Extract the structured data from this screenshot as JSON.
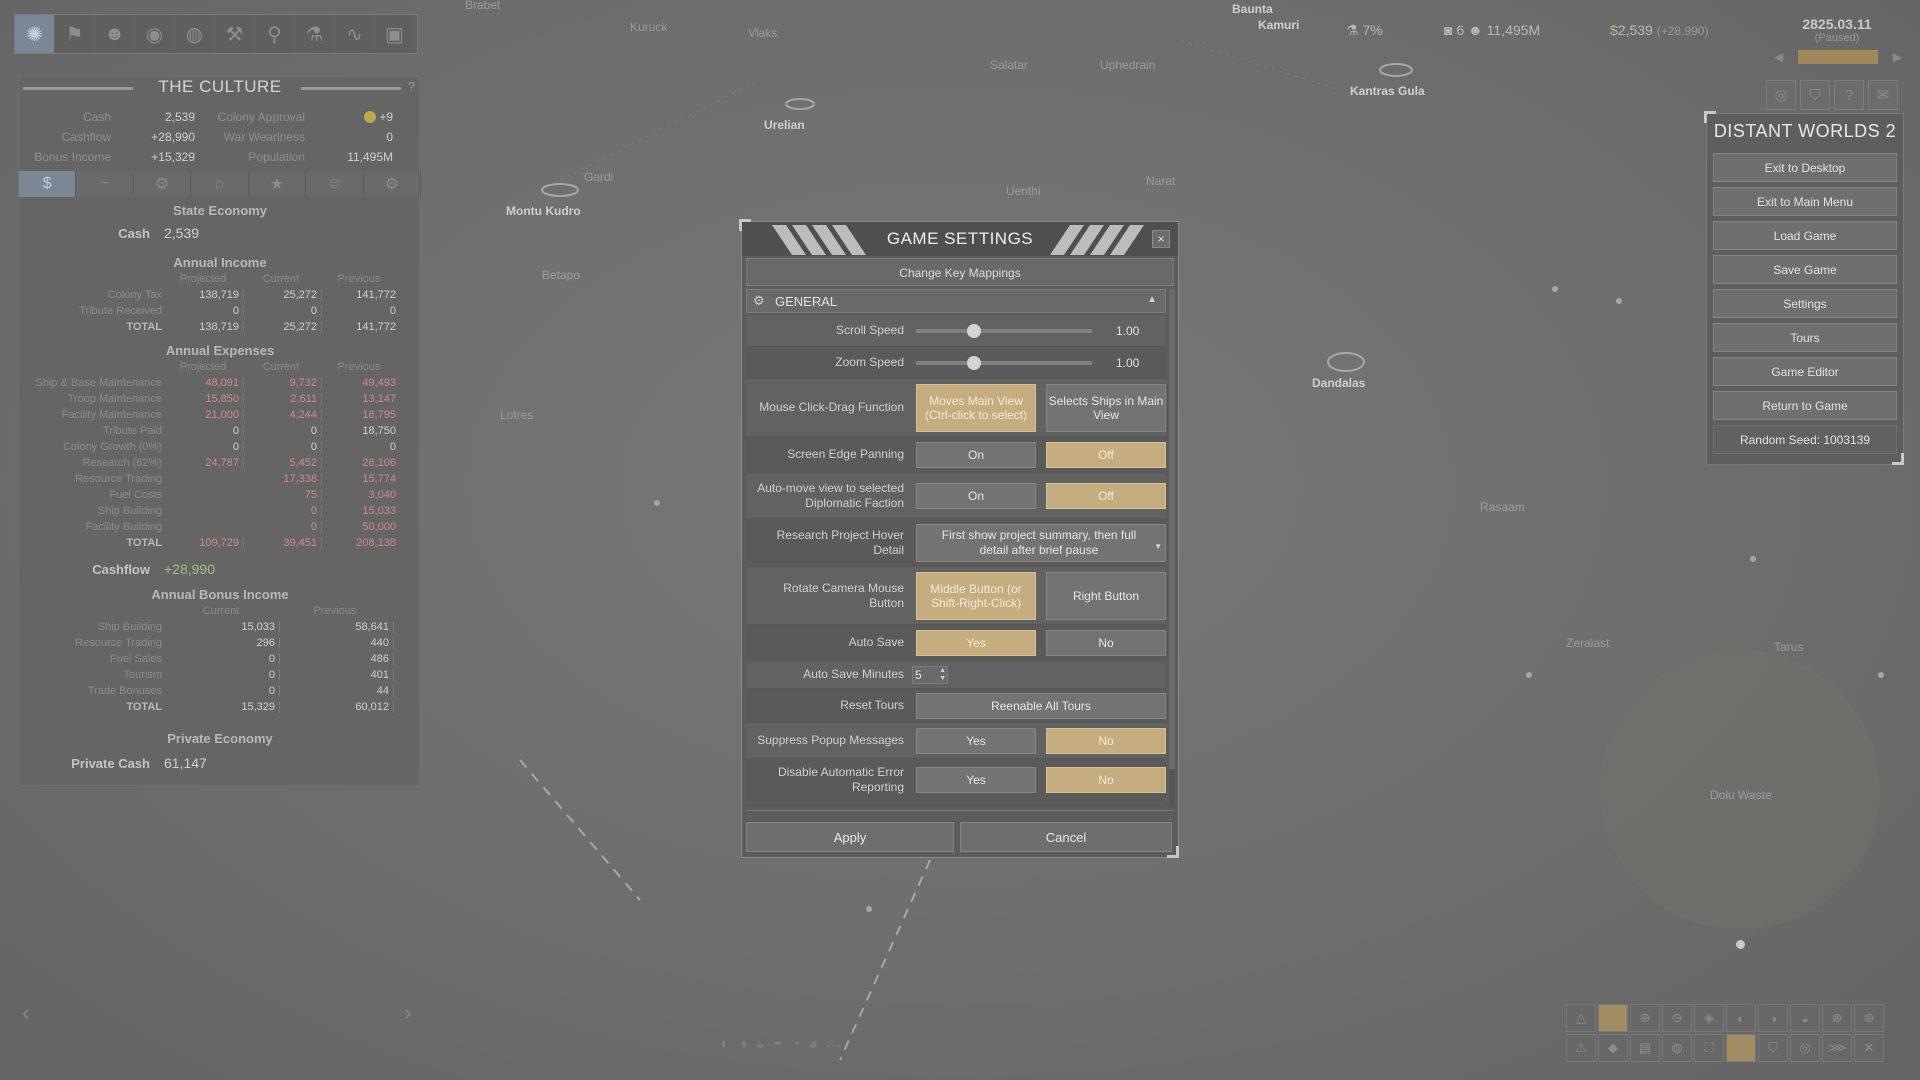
{
  "map": {
    "labels": [
      "Brabet",
      "Kuruck",
      "Vlaks",
      "Salatar",
      "Uphedrain",
      "Kamuri",
      "Baunta",
      "Kantras Gula",
      "Urelian",
      "Montu Kudro",
      "Gardi",
      "Narat",
      "Uenthi",
      "Betapo",
      "Lotres",
      "Dandalas",
      "Zeralast",
      "Dolu Waste",
      "Tarus",
      "Rasaam"
    ]
  },
  "toolbar": {
    "icons": [
      "empire-icon",
      "flag-icon",
      "person-icon",
      "camera-icon",
      "globe-icon",
      "tools-icon",
      "pin-icon",
      "flask-icon",
      "graph-icon",
      "factory-icon"
    ]
  },
  "empire": {
    "title": "THE CULTURE",
    "help": "?",
    "stats": [
      {
        "l1": "Cash",
        "v1": "2,539",
        "l2": "Colony Approval",
        "v2": "+9"
      },
      {
        "l1": "Cashflow",
        "v1": "+28,990",
        "l2": "War Weariness",
        "v2": "0"
      },
      {
        "l1": "Bonus Income",
        "v1": "+15,329",
        "l2": "Population",
        "v2": "11,495M"
      }
    ],
    "tabs": [
      "$",
      "~",
      "⚙",
      "⌂",
      "★",
      "☺",
      "⚙"
    ],
    "state_economy": "State Economy",
    "cash_label": "Cash",
    "cash_value": "2,539",
    "annual_income": "Annual Income",
    "col_projected": "Projected",
    "col_current": "Current",
    "col_previous": "Previous",
    "income_rows": [
      {
        "name": "Colony Tax",
        "p": "138,719",
        "c": "25,272",
        "v": "141,772"
      },
      {
        "name": "Tribute Received",
        "p": "0",
        "c": "0",
        "v": "0"
      },
      {
        "name": "TOTAL",
        "p": "138,719",
        "c": "25,272",
        "v": "141,772"
      }
    ],
    "annual_expenses": "Annual Expenses",
    "expense_rows": [
      {
        "name": "Ship & Base Maintenance",
        "p": "48,091",
        "c": "9,732",
        "v": "49,493",
        "red": true
      },
      {
        "name": "Troop Maintenance",
        "p": "15,850",
        "c": "2,611",
        "v": "13,147",
        "red": true
      },
      {
        "name": "Facility Maintenance",
        "p": "21,000",
        "c": "4,244",
        "v": "16,795",
        "red": true
      },
      {
        "name": "Tribute Paid",
        "p": "0",
        "c": "0",
        "v": "18,750",
        "red": false
      },
      {
        "name": "Colony Growth (0%)",
        "p": "0",
        "c": "0",
        "v": "0",
        "red": false
      },
      {
        "name": "Research (62%)",
        "p": "24,787",
        "c": "5,452",
        "v": "26,106",
        "red": true
      },
      {
        "name": "Resource Trading",
        "p": "",
        "c": "17,338",
        "v": "15,774",
        "red": true
      },
      {
        "name": "Fuel Costs",
        "p": "",
        "c": "75",
        "v": "3,040",
        "red": true
      },
      {
        "name": "Ship Building",
        "p": "",
        "c": "0",
        "v": "15,033",
        "red": true
      },
      {
        "name": "Facility Building",
        "p": "",
        "c": "0",
        "v": "50,000",
        "red": true
      },
      {
        "name": "TOTAL",
        "p": "109,729",
        "c": "39,451",
        "v": "208,138",
        "red": true
      }
    ],
    "cashflow_label": "Cashflow",
    "cashflow_value": "+28,990",
    "annual_bonus": "Annual Bonus Income",
    "bonus_rows": [
      {
        "name": "Ship Building",
        "c": "15,033",
        "v": "58,641"
      },
      {
        "name": "Resource Trading",
        "c": "296",
        "v": "440"
      },
      {
        "name": "Fuel Sales",
        "c": "0",
        "v": "486"
      },
      {
        "name": "Tourism",
        "c": "0",
        "v": "401"
      },
      {
        "name": "Trade Bonuses",
        "c": "0",
        "v": "44"
      },
      {
        "name": "TOTAL",
        "c": "15,329",
        "v": "60,012"
      }
    ],
    "private_economy": "Private Economy",
    "private_cash_label": "Private Cash",
    "private_cash_value": "61,147"
  },
  "hud": {
    "research": "7%",
    "colonies": "6",
    "population": "11,495M",
    "cash": "2,539",
    "cashflow": "(+28,990)",
    "date": "2825.03.11",
    "paused": "(Paused)"
  },
  "main_menu": {
    "title": "DISTANT WORLDS 2",
    "buttons": [
      "Exit to Desktop",
      "Exit to Main Menu",
      "Load Game",
      "Save Game",
      "Settings",
      "Tours",
      "Game Editor",
      "Return to Game"
    ],
    "seed": "Random Seed: 1003139"
  },
  "settings": {
    "title": "GAME SETTINGS",
    "close": "×",
    "key_mappings": "Change Key Mappings",
    "section": "GENERAL",
    "scroll_speed": {
      "label": "Scroll Speed",
      "value": "1.00",
      "level": 0.33
    },
    "zoom_speed": {
      "label": "Zoom Speed",
      "value": "1.00",
      "level": 0.33
    },
    "mouse_drag": {
      "label": "Mouse Click-Drag Function",
      "opt1": "Moves Main View (Ctrl-click to select)",
      "opt2": "Selects Ships in Main View",
      "selected": 1
    },
    "edge_pan": {
      "label": "Screen Edge Panning",
      "opt1": "On",
      "opt2": "Off",
      "selected": 2
    },
    "auto_move": {
      "label": "Auto-move view to selected Diplomatic Faction",
      "opt1": "On",
      "opt2": "Off",
      "selected": 2
    },
    "hover_detail": {
      "label": "Research Project Hover Detail",
      "value": "First show project summary, then full detail after brief pause"
    },
    "rotate_camera": {
      "label": "Rotate Camera Mouse Button",
      "opt1": "Middle Button (or Shift-Right-Click)",
      "opt2": "Right Button",
      "selected": 1
    },
    "auto_save": {
      "label": "Auto Save",
      "opt1": "Yes",
      "opt2": "No",
      "selected": 1
    },
    "auto_save_minutes": {
      "label": "Auto Save Minutes",
      "value": "5"
    },
    "reset_tours": {
      "label": "Reset Tours",
      "button": "Reenable All Tours"
    },
    "suppress_popups": {
      "label": "Suppress Popup Messages",
      "opt1": "Yes",
      "opt2": "No",
      "selected": 2
    },
    "error_reporting": {
      "label": "Disable Automatic Error Reporting",
      "opt1": "Yes",
      "opt2": "No",
      "selected": 2
    },
    "apply": "Apply",
    "cancel": "Cancel"
  },
  "colors": {
    "selected_option": "#c6ad80",
    "cashflow_green": "#9cc080",
    "expense_red": "#d08a8a",
    "active_tab": "#7b8795"
  }
}
